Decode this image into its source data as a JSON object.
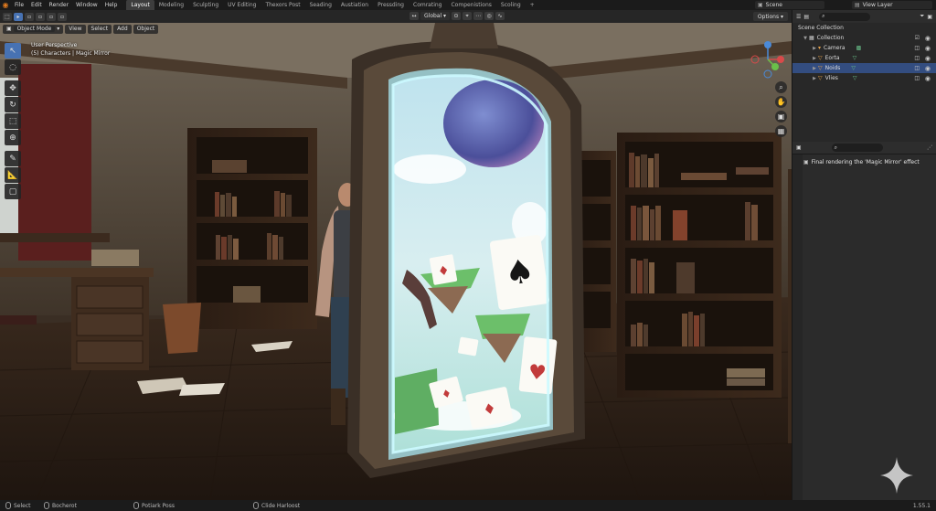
{
  "menu": {
    "items": [
      "File",
      "Edit",
      "Render",
      "Window",
      "Help"
    ],
    "workspaces": [
      "Layout",
      "Modeling",
      "Sculpting",
      "UV Editing",
      "Thexors Post",
      "Seading",
      "Austiation",
      "Pressding",
      "Comrating",
      "Compenistions",
      "Scoling",
      "+"
    ],
    "active_workspace": "Layout",
    "scene_label": "Scene",
    "view_layer_label": "View Layer"
  },
  "viewport_header": {
    "mode": "Object Mode",
    "menus": [
      "View",
      "Select",
      "Add",
      "Object"
    ],
    "transform": "Global",
    "options_label": "Options"
  },
  "viewport": {
    "view_name": "User Perspective",
    "collection_info": "(5) Characters | Magic Mirror"
  },
  "outliner": {
    "root": "Scene Collection",
    "collection": "Collection",
    "items": [
      {
        "name": "Camera",
        "selected": false
      },
      {
        "name": "Eorta",
        "selected": false
      },
      {
        "name": "Noids",
        "selected": true
      },
      {
        "name": "Vlies",
        "selected": false
      }
    ]
  },
  "properties": {
    "message": "Final rendering the 'Magic Mirror' effect"
  },
  "statusbar": {
    "left": "Select",
    "item2": "Bocherot",
    "item3": "Potiark Poss",
    "item4": "Clide Harloost",
    "version": "1.55.1"
  },
  "colors": {
    "accent": "#4772b3",
    "selection": "#334d80",
    "panel": "#282828",
    "header": "#1b1b1b"
  }
}
